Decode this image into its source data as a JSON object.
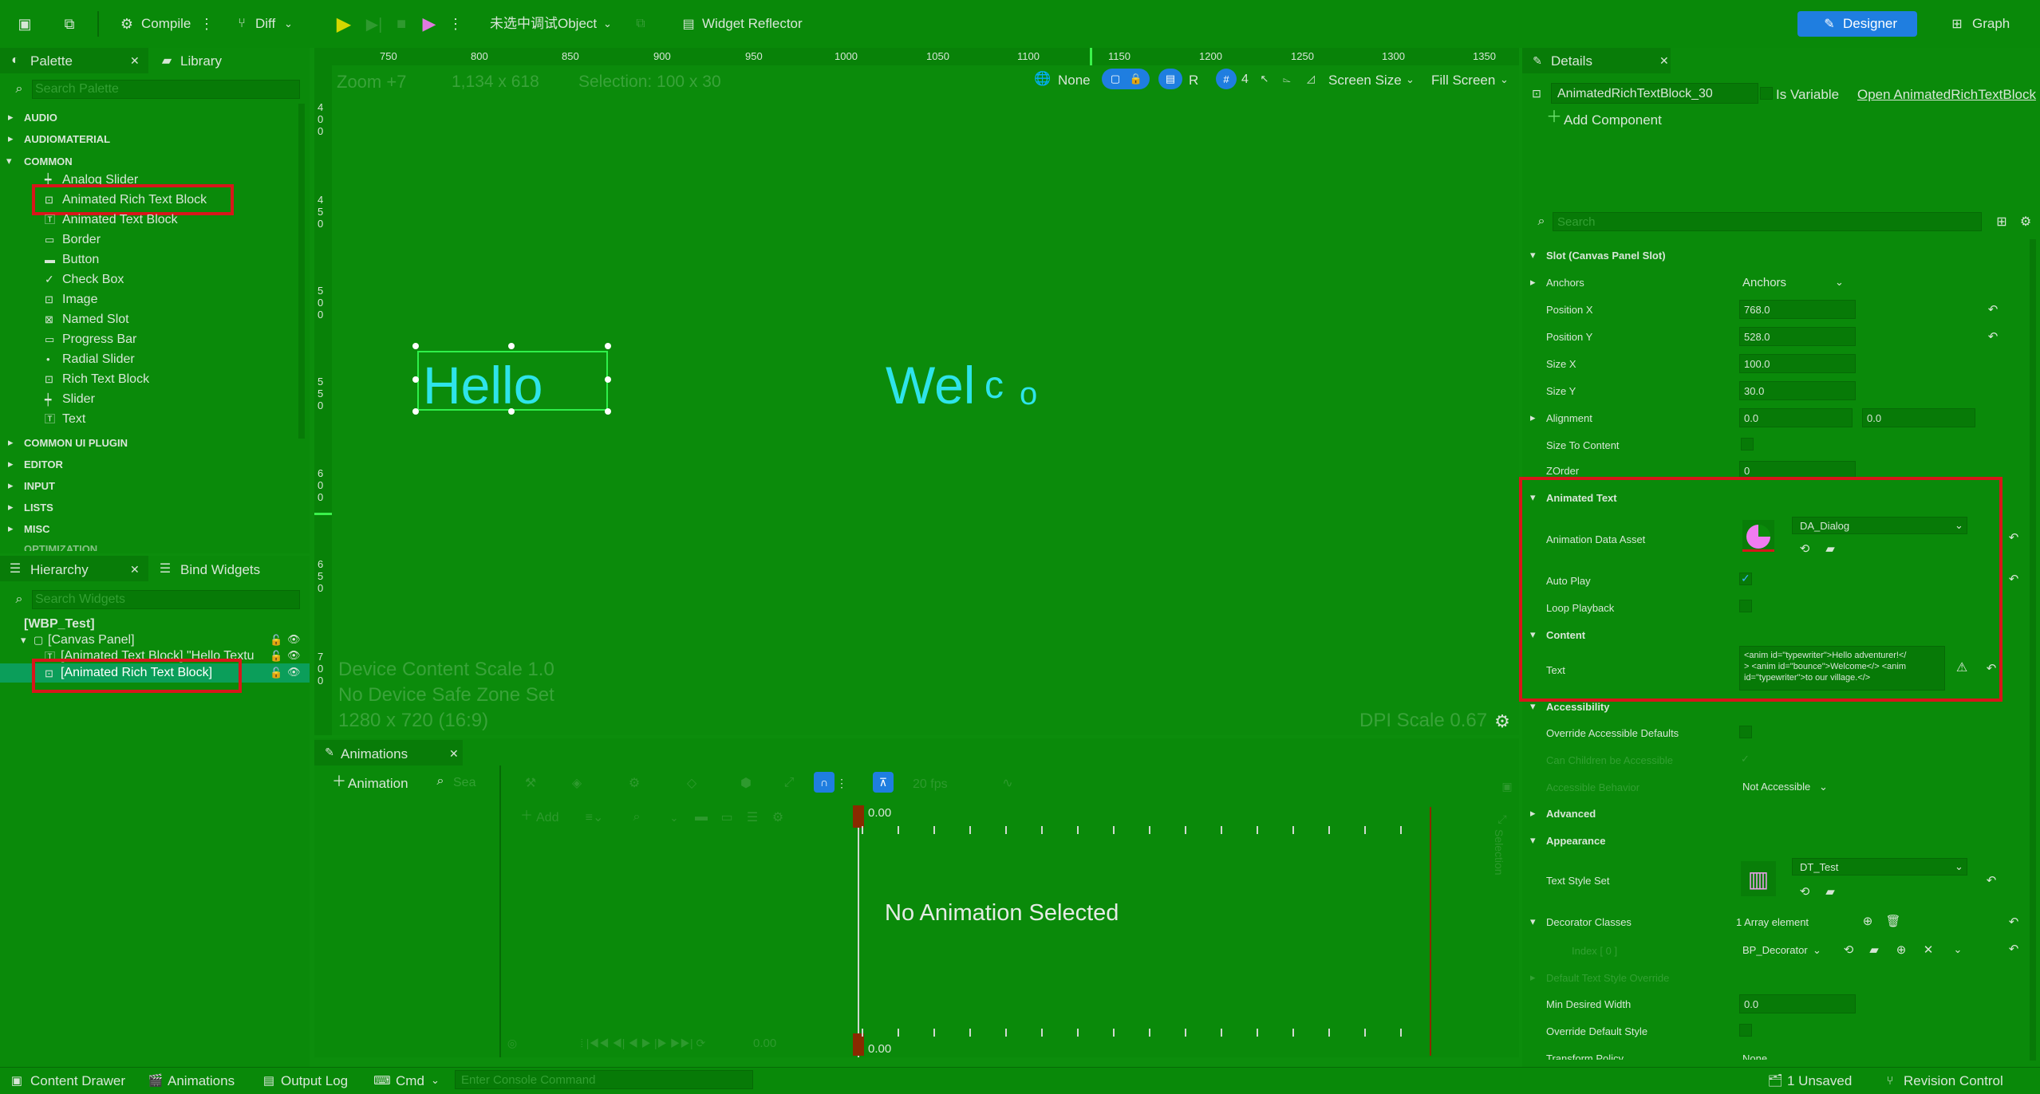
{
  "toolbar": {
    "compile": "Compile",
    "diff": "Diff",
    "debug_object": "未选中调试Object",
    "widget_reflector": "Widget Reflector",
    "designer": "Designer",
    "graph": "Graph"
  },
  "palette": {
    "tab": "Palette",
    "library_tab": "Library",
    "search_placeholder": "Search Palette",
    "categories": {
      "audio": "AUDIO",
      "audiomaterial": "AUDIOMATERIAL",
      "common": "COMMON",
      "common_ui_plugin": "COMMON UI PLUGIN",
      "editor": "EDITOR",
      "input": "INPUT",
      "lists": "LISTS",
      "misc": "MISC",
      "optimization": "OPTIMIZATION"
    },
    "items": [
      "Analog Slider",
      "Animated Rich Text Block",
      "Animated Text Block",
      "Border",
      "Button",
      "Check Box",
      "Image",
      "Named Slot",
      "Progress Bar",
      "Radial Slider",
      "Rich Text Block",
      "Slider",
      "Text"
    ]
  },
  "hierarchy": {
    "tab": "Hierarchy",
    "bind_tab": "Bind Widgets",
    "search_placeholder": "Search Widgets",
    "root": "[WBP_Test]",
    "canvas": "[Canvas Panel]",
    "item1": "[Animated Text Block] \"Hello Textu",
    "item2": "[Animated Rich Text Block]"
  },
  "viewport": {
    "ruler_x": [
      "750",
      "800",
      "850",
      "900",
      "950",
      "1000",
      "1050",
      "1100",
      "1150",
      "1200",
      "1250",
      "1300",
      "1350"
    ],
    "zoom": "Zoom +7",
    "size": "1,134 x 618",
    "selection": "Selection: 100 x 30",
    "none": "None",
    "r": "R",
    "grid": "4",
    "screen_size": "Screen Size",
    "fill_screen": "Fill Screen",
    "hello": "Hello",
    "welco_a": "Wel",
    "welco_b": "c",
    "welco_c": "o",
    "device_scale": "Device Content Scale 1.0",
    "safe_zone": "No Device Safe Zone Set",
    "resolution": "1280 x 720 (16:9)",
    "dpi": "DPI Scale 0.67",
    "ruler_y": [
      "4",
      "0",
      "0",
      "4",
      "5",
      "0",
      "5",
      "0",
      "0",
      "5",
      "5",
      "0",
      "6",
      "0",
      "0",
      "6",
      "5",
      "0",
      "7",
      "0",
      "0"
    ]
  },
  "animations": {
    "tab": "Animations",
    "add_animation": "Animation",
    "search_placeholder": "Sea",
    "fps": "20 fps",
    "add": "Add",
    "time_top": "0.00",
    "time_bottom": "0.00",
    "time_left": "0.00",
    "empty": "No Animation Selected",
    "selection_side": "Selection"
  },
  "details": {
    "tab": "Details",
    "widget_name": "AnimatedRichTextBlock_30",
    "is_variable": "Is Variable",
    "open": "Open AnimatedRichTextBlock",
    "add_component": "Add Component",
    "search_placeholder": "Search",
    "slot": {
      "header": "Slot (Canvas Panel Slot)",
      "anchors_label": "Anchors",
      "anchors_value": "Anchors",
      "pos_x_label": "Position X",
      "pos_x": "768.0",
      "pos_y_label": "Position Y",
      "pos_y": "528.0",
      "size_x_label": "Size X",
      "size_x": "100.0",
      "size_y_label": "Size Y",
      "size_y": "30.0",
      "alignment_label": "Alignment",
      "align_x": "0.0",
      "align_y": "0.0",
      "size_to_content": "Size To Content",
      "zorder_label": "ZOrder",
      "zorder": "0"
    },
    "animated_text": {
      "header": "Animated Text",
      "data_asset_label": "Animation Data Asset",
      "data_asset": "DA_Dialog",
      "auto_play": "Auto Play",
      "loop": "Loop Playback"
    },
    "content": {
      "header": "Content",
      "text_label": "Text",
      "text_line1": "<anim id=\"typewriter\">Hello adventurer!</",
      "text_line2": "> <anim id=\"bounce\">Welcome</> <anim",
      "text_line3": "id=\"typewriter\">to our village.</>"
    },
    "accessibility": {
      "header": "Accessibility",
      "override": "Override Accessible Defaults",
      "children": "Can Children be Accessible",
      "behavior": "Accessible Behavior",
      "behavior_value": "Not Accessible"
    },
    "advanced": "Advanced",
    "appearance": {
      "header": "Appearance",
      "style_set_label": "Text Style Set",
      "style_set": "DT_Test",
      "decorators_label": "Decorator Classes",
      "decorators_count": "1 Array element",
      "index_label": "Index [ 0 ]",
      "decorator_value": "BP_Decorator",
      "default_override": "Default Text Style Override",
      "min_width_label": "Min Desired Width",
      "min_width": "0.0",
      "override_default": "Override Default Style",
      "transform_policy": "Transform Policy",
      "transform_value": "None"
    }
  },
  "statusbar": {
    "content_drawer": "Content Drawer",
    "animations": "Animations",
    "output_log": "Output Log",
    "cmd": "Cmd",
    "console_placeholder": "Enter Console Command",
    "unsaved": "1 Unsaved",
    "revision": "Revision Control"
  }
}
